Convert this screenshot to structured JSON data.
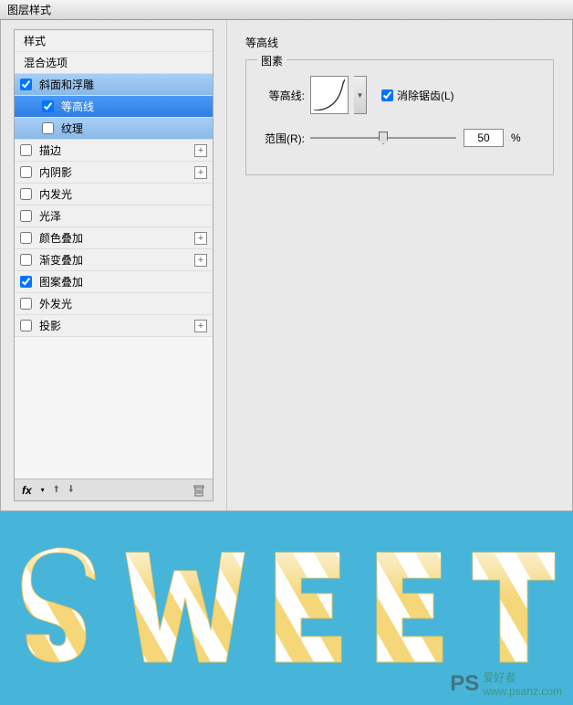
{
  "window": {
    "title": "图层样式"
  },
  "styles": {
    "header1": "样式",
    "header2": "混合选项",
    "items": [
      {
        "label": "斜面和浮雕",
        "checked": true,
        "highlight": true
      },
      {
        "label": "等高线",
        "checked": true,
        "selected": true,
        "indent": true
      },
      {
        "label": "纹理",
        "checked": false,
        "highlight": true,
        "indent": true
      },
      {
        "label": "描边",
        "checked": false,
        "add": true
      },
      {
        "label": "内阴影",
        "checked": false,
        "add": true
      },
      {
        "label": "内发光",
        "checked": false
      },
      {
        "label": "光泽",
        "checked": false
      },
      {
        "label": "颜色叠加",
        "checked": false,
        "add": true
      },
      {
        "label": "渐变叠加",
        "checked": false,
        "add": true
      },
      {
        "label": "图案叠加",
        "checked": true
      },
      {
        "label": "外发光",
        "checked": false
      },
      {
        "label": "投影",
        "checked": false,
        "add": true
      }
    ],
    "fx_label": "fx"
  },
  "right": {
    "title": "等高线",
    "fieldset": "图素",
    "contour_label": "等高线:",
    "antialias": "消除锯齿(L)",
    "antialias_checked": true,
    "range_label": "范围(R):",
    "range_value": "50",
    "percent": "%"
  },
  "preview": {
    "text": "SWEET"
  },
  "watermark": {
    "ps": "PS",
    "name": "爱好者",
    "url": "www.psahz.com"
  }
}
